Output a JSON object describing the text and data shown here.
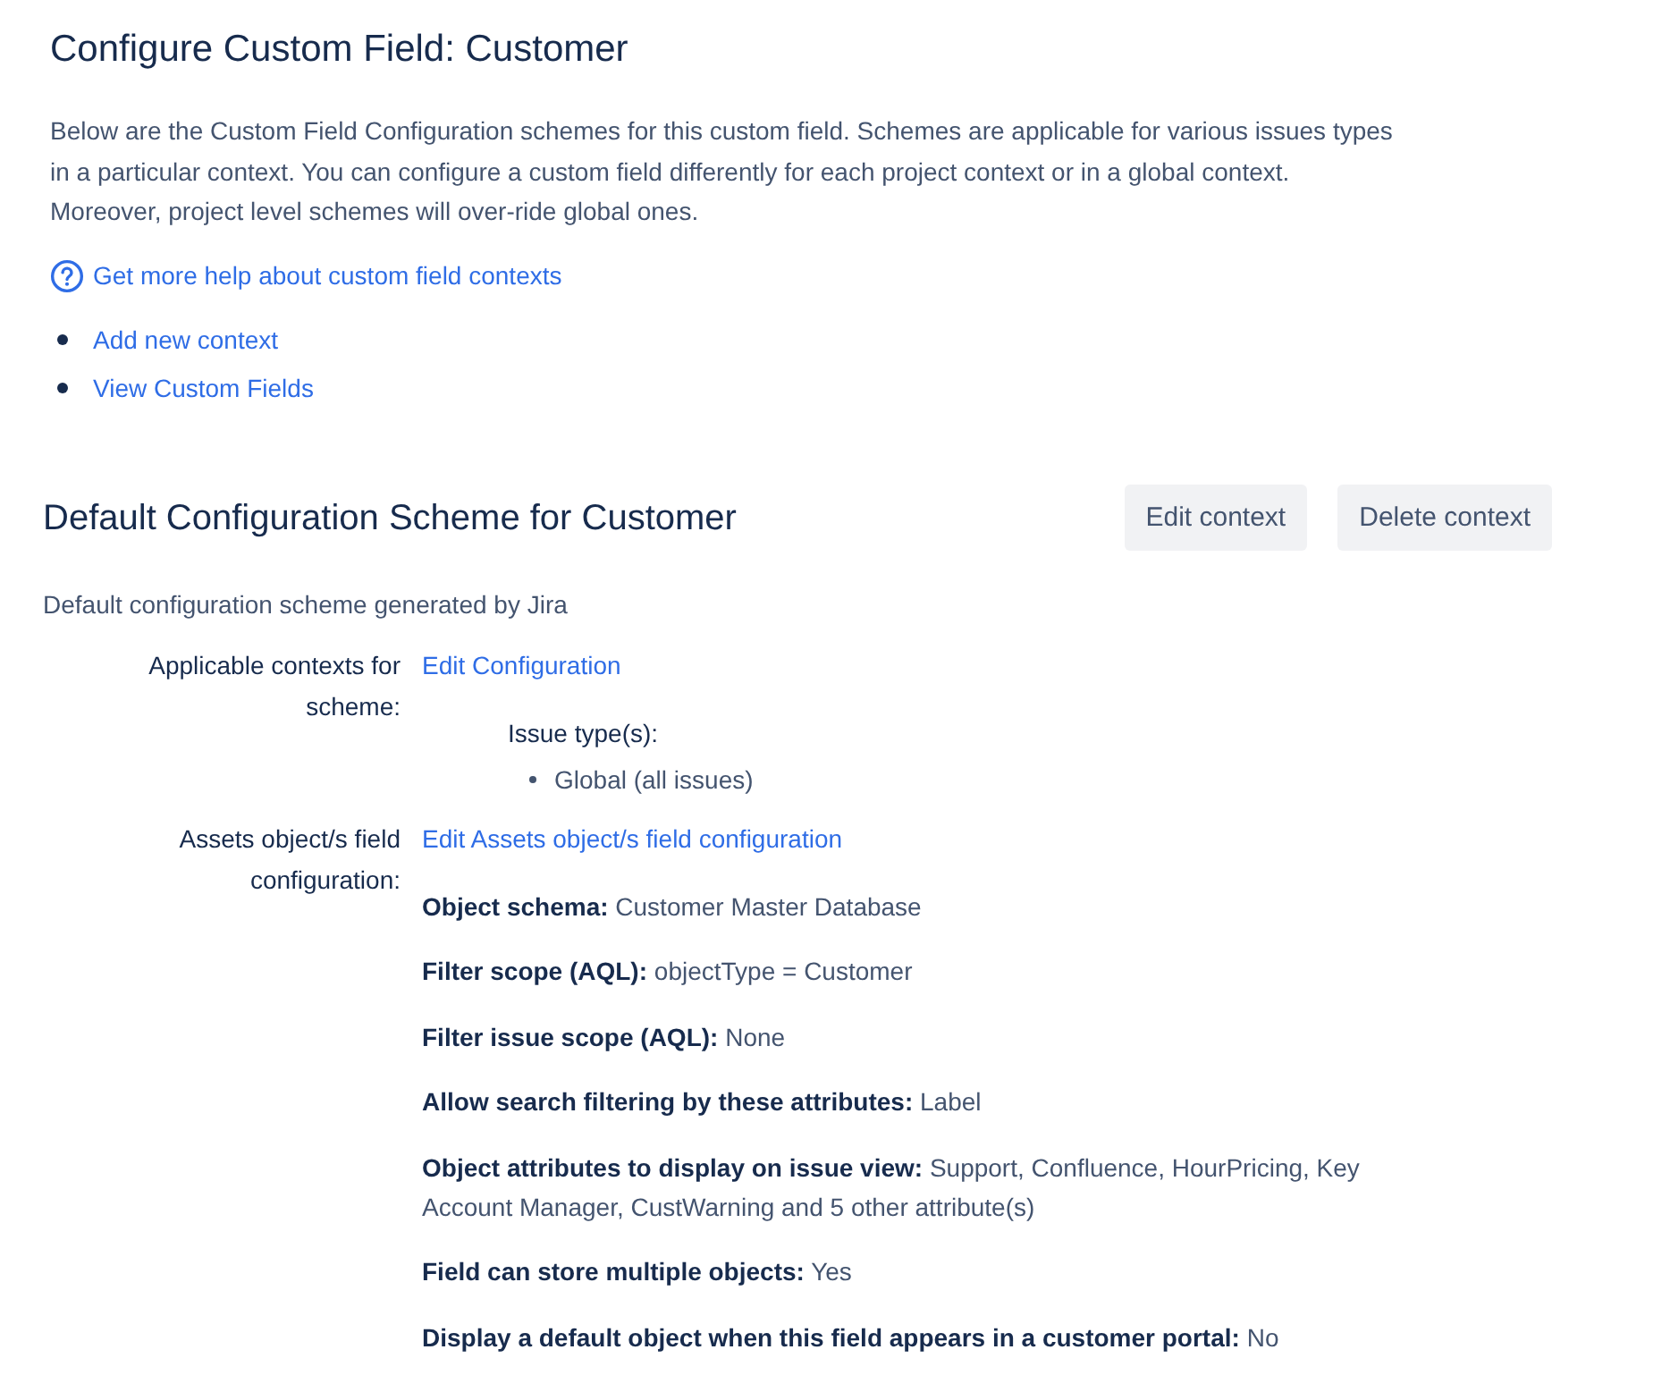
{
  "page": {
    "title": "Configure Custom Field: Customer",
    "description": "Below are the Custom Field Configuration schemes for this custom field. Schemes are applicable for various issues types in a particular context. You can configure a custom field differently for each project context or in a global context. Moreover, project level schemes will over-ride global ones.",
    "help_link": "Get more help about custom field contexts",
    "links": [
      "Add new context",
      "View Custom Fields"
    ]
  },
  "scheme": {
    "title": "Default Configuration Scheme for Customer",
    "buttons": [
      "Edit context",
      "Delete context"
    ],
    "description": "Default configuration scheme generated by Jira",
    "rows": [
      {
        "kind": "contexts",
        "label": "Applicable contexts for scheme:",
        "link": "Edit Configuration",
        "issue_types_label": "Issue type(s):",
        "issue_types": [
          "Global (all issues)"
        ]
      },
      {
        "kind": "settings",
        "label": "Assets object/s field configuration:",
        "link": "Edit Assets object/s field configuration",
        "settings": [
          "**Object schema:** Customer Master Database",
          "**Filter scope (AQL):** objectType = Customer",
          "**Filter issue scope (AQL):** None",
          "**Allow search filtering by these attributes:** Label",
          "**Object attributes to display on issue view:** Support, Confluence, HourPricing, Key Account Manager, CustWarning and 5 other attribute(s)",
          "**Field can store multiple objects:** Yes",
          "**Display a default object when this field appears in a customer portal:** No"
        ]
      }
    ]
  }
}
